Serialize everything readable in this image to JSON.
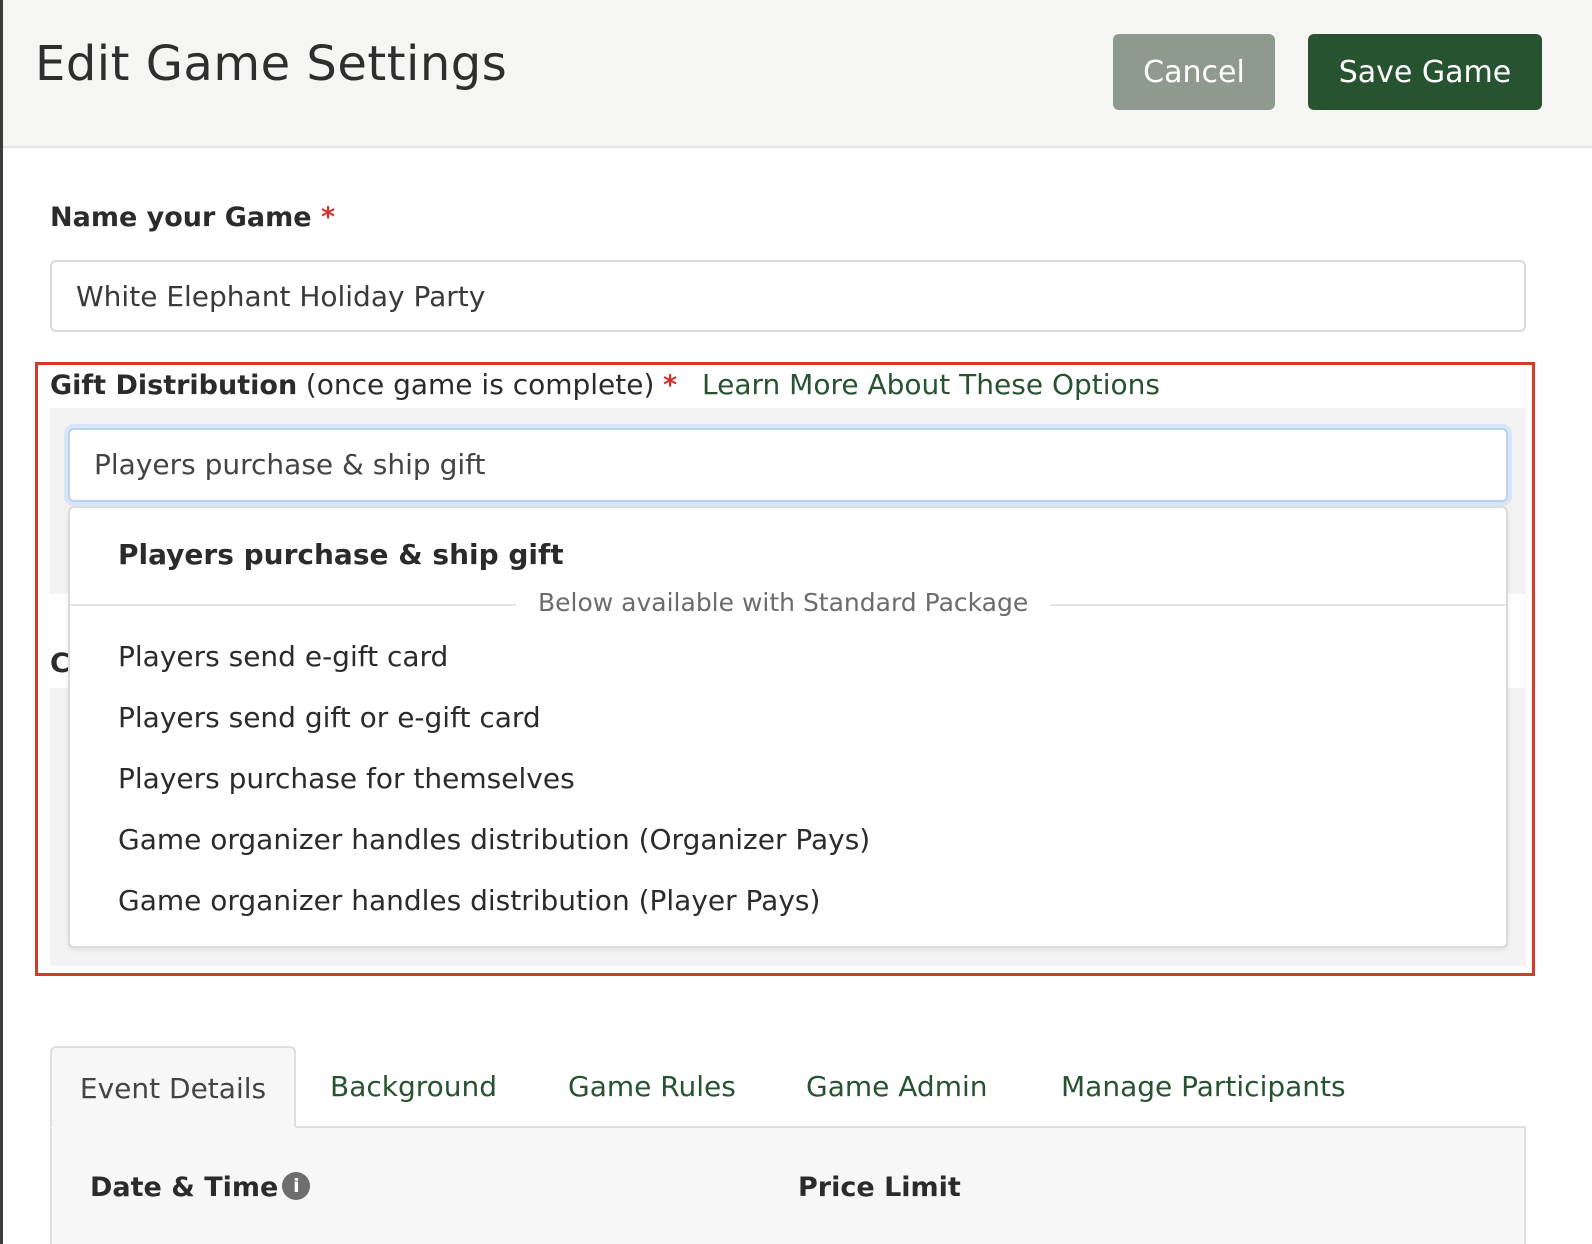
{
  "header": {
    "title": "Edit Game Settings",
    "cancel_label": "Cancel",
    "save_label": "Save Game"
  },
  "name_field": {
    "label": "Name your Game",
    "required_mark": "*",
    "value": "White Elephant Holiday Party"
  },
  "gift_distribution": {
    "label": "Gift Distribution",
    "label_suffix": "(once game is complete)",
    "required_mark": "*",
    "learn_more": "Learn More About These Options",
    "selected_value": "Players purchase & ship gift",
    "options": {
      "selected": "Players purchase & ship gift",
      "divider_text": "Below available with Standard Package",
      "items": [
        "Players send e-gift card",
        "Players send gift or e-gift card",
        "Players purchase for themselves",
        "Game organizer handles distribution (Organizer Pays)",
        "Game organizer handles distribution (Player Pays)"
      ]
    }
  },
  "hidden_section_initial": "C",
  "tabs": [
    {
      "label": "Event Details",
      "active": true
    },
    {
      "label": "Background"
    },
    {
      "label": "Game Rules"
    },
    {
      "label": "Game Admin"
    },
    {
      "label": "Manage Participants"
    }
  ],
  "event_details": {
    "date_time_label": "Date & Time",
    "price_limit_label": "Price Limit",
    "info_icon": "info-icon"
  },
  "colors": {
    "primary": "#275331",
    "cancel": "#8f9a8e",
    "required": "#d0312d",
    "highlight_border": "#d33a2c"
  }
}
